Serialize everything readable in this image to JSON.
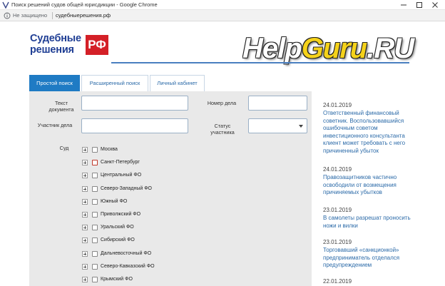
{
  "window": {
    "title": "Поиск решений судов общей юрисдикции - Google Chrome"
  },
  "addressbar": {
    "security": "Не защищено",
    "url": "судебныерешения.рф"
  },
  "logo": {
    "line1": "Судебные",
    "line2": "решения",
    "badge": "РФ",
    "colors": {
      "text": "#1f3e94",
      "badge": "#d42027"
    }
  },
  "watermark": {
    "part1": "Help",
    "part2": "Guru",
    "part3": ".RU"
  },
  "tabs": [
    {
      "label": "Простой поиск",
      "active": true
    },
    {
      "label": "Расширенный поиск",
      "active": false
    },
    {
      "label": "Личный кабинет",
      "active": false
    }
  ],
  "form": {
    "doc_text_label_line1": "Текст",
    "doc_text_label_line2": "документа",
    "case_number_label": "Номер дела",
    "participant_label": "Участник дела",
    "status_label_line1": "Статус",
    "status_label_line2": "участника",
    "status_selected": "",
    "court_label": "Суд",
    "courts": [
      "Москва",
      "Санкт-Петербург",
      "Центральный ФО",
      "Северо-Западный ФО",
      "Южный ФО",
      "Приволжский ФО",
      "Уральский ФО",
      "Сибирский ФО",
      "Дальневосточный ФО",
      "Северо-Кавказский ФО",
      "Крымский ФО"
    ]
  },
  "news": [
    {
      "date": "24.01.2019",
      "text": "Ответственный финансовый советник. Воспользовавшийся ошибочным советом инвестиционного консультанта клиент может требовать с него причиненный убыток"
    },
    {
      "date": "24.01.2019",
      "text": "Правозащитников частично освободили от возмещения причиняемых убытков"
    },
    {
      "date": "23.01.2019",
      "text": "В самолеты разрешат проносить ножи и вилки"
    },
    {
      "date": "23.01.2019",
      "text": "Торговавший «санкционкой» предприниматель отделался предупреждением"
    },
    {
      "date": "22.01.2019",
      "text": ""
    }
  ],
  "colors": {
    "accent": "#1f7bc4",
    "link": "#2b6aa8",
    "panel": "#e9e9e9"
  }
}
